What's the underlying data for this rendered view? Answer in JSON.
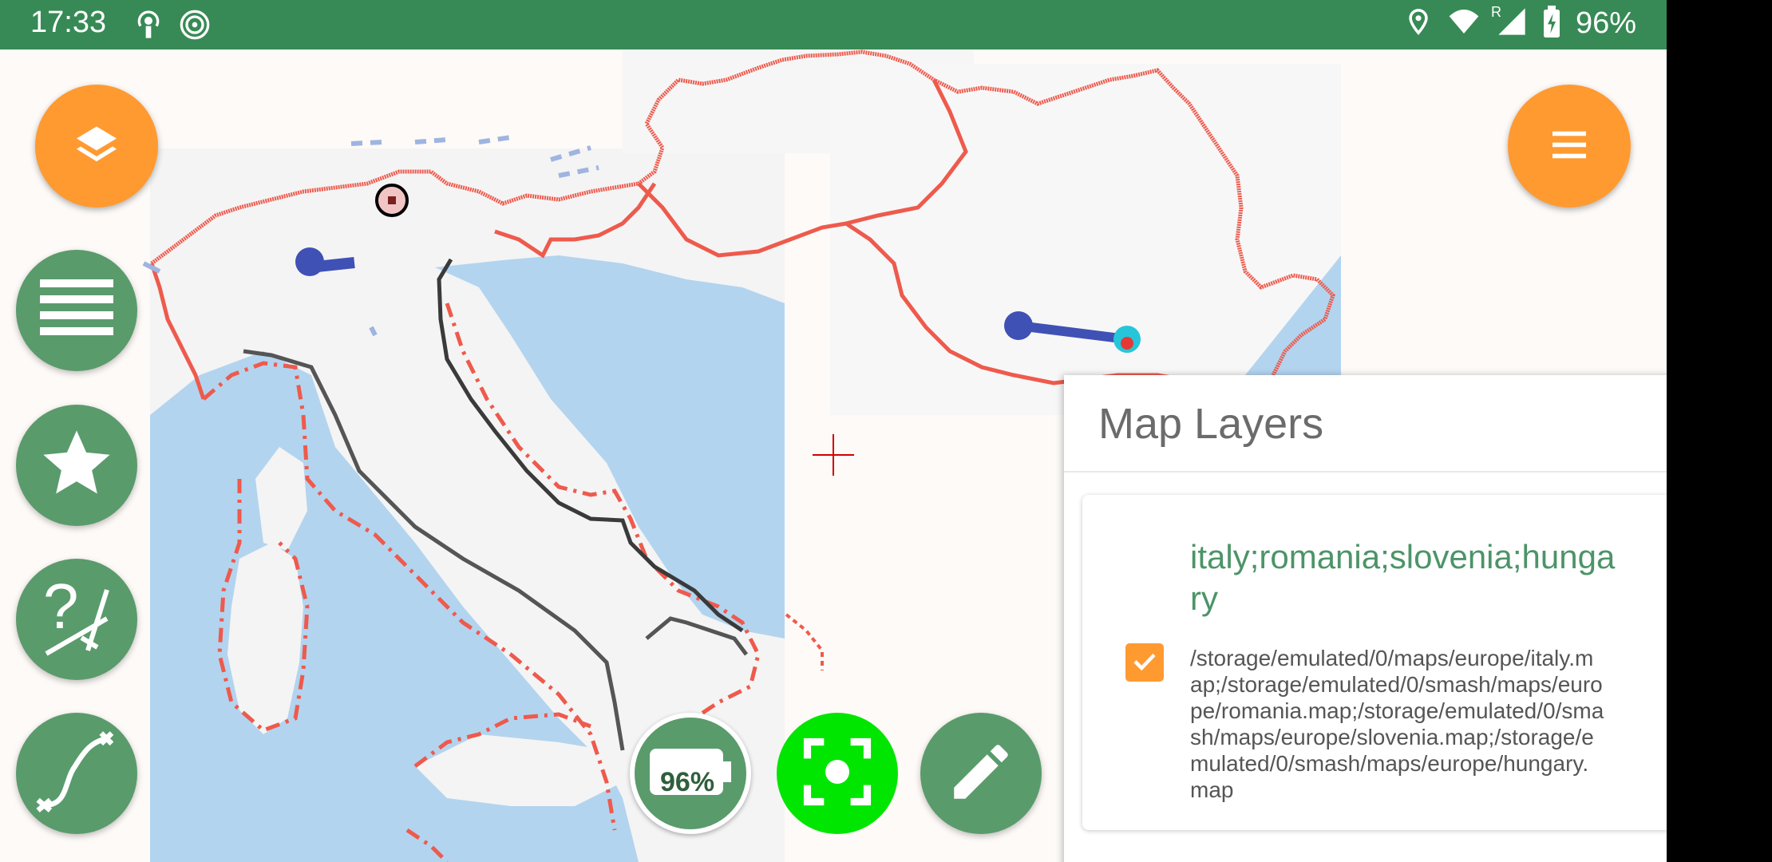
{
  "status_bar": {
    "time": "17:33",
    "left_icons": [
      "podcast-icon",
      "nfc-icon"
    ],
    "right_icons": [
      "location-icon",
      "wifi-icon",
      "signal-icon",
      "battery-icon"
    ],
    "roaming_label": "R",
    "battery_percent": "96%"
  },
  "map": {
    "crosshair_color": "#d00000",
    "border_color": "#ee5a4c",
    "water_color": "#b3d4ef"
  },
  "toolbar": {
    "layers_button_icon": "layers-icon",
    "menu_button_icon": "menu-icon",
    "left_buttons": [
      "list-icon",
      "star-icon",
      "help-measure-icon",
      "spline-icon"
    ],
    "battery_label": "96%",
    "bottom_buttons": [
      "battery-status-icon",
      "center-on-gps-icon",
      "edit-icon"
    ]
  },
  "colors": {
    "accent_orange": "#ff9a31",
    "primary_green": "#5a9b6c",
    "status_green": "#378a55",
    "gps_green": "#00e600"
  },
  "layers_panel": {
    "title": "Map Layers",
    "layers": [
      {
        "name": "italy;romania;slovenia;hungary",
        "path": "/storage/emulated/0/maps/europe/italy.map;/storage/emulated/0/smash/maps/europe/romania.map;/storage/emulated/0/smash/maps/europe/slovenia.map;/storage/emulated/0/smash/maps/europe/hungary.map",
        "checked": true
      }
    ]
  }
}
